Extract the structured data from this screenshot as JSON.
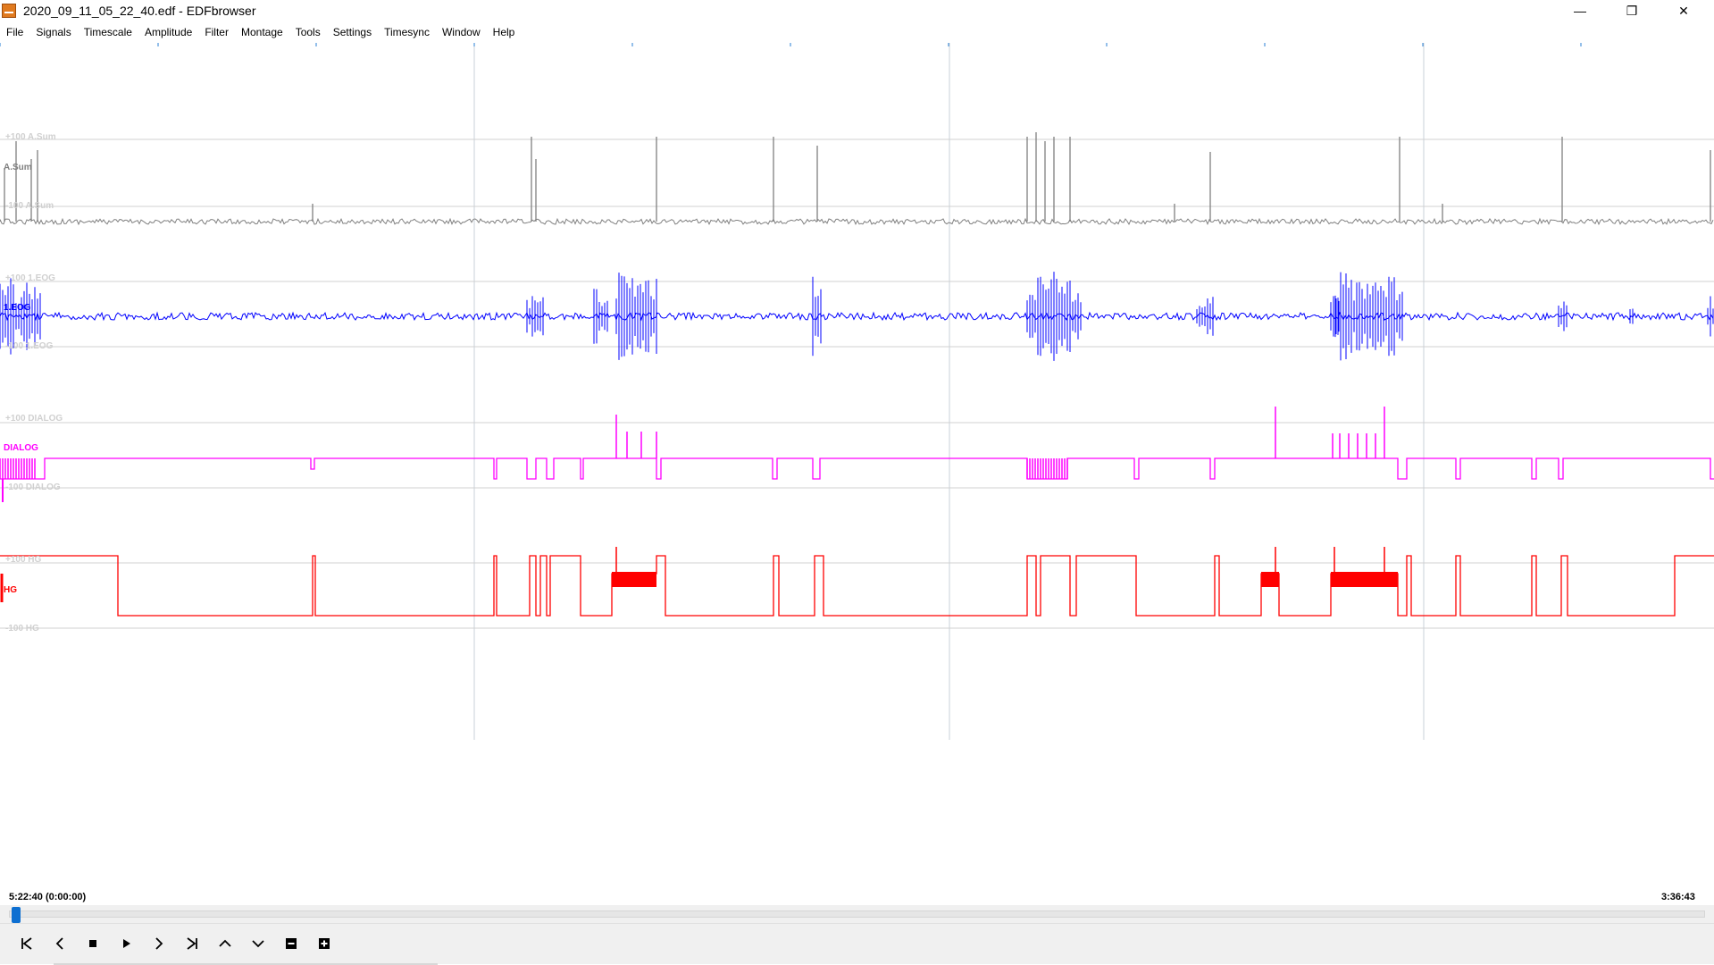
{
  "window": {
    "title": "2020_09_11_05_22_40.edf - EDFbrowser",
    "controls": {
      "minimize": "—",
      "restore": "❐",
      "close": "✕"
    }
  },
  "menu": [
    "File",
    "Signals",
    "Timescale",
    "Amplitude",
    "Filter",
    "Montage",
    "Tools",
    "Settings",
    "Timesync",
    "Window",
    "Help"
  ],
  "signals": [
    {
      "name": "A.Sum",
      "color": "#808080",
      "top_label": "+100 A.Sum",
      "bottom_label": "-100 A.Sum"
    },
    {
      "name": "1.EOG",
      "color": "#0000ff",
      "top_label": "+100 1.EOG",
      "bottom_label": "-100 1.EOG"
    },
    {
      "name": "DIALOG",
      "color": "#ff00ff",
      "top_label": "+100 DIALOG",
      "bottom_label": "-100 DIALOG"
    },
    {
      "name": "HG",
      "color": "#ff0000",
      "top_label": "+100 HG",
      "bottom_label": "-100 HG"
    }
  ],
  "timeline": {
    "start": "5:22:40 (0:00:00)",
    "end": "3:36:43"
  },
  "toolbar": {
    "buttons": [
      {
        "name": "first-page",
        "icon": "skip-back-icon"
      },
      {
        "name": "previous-page",
        "icon": "chevron-left-icon"
      },
      {
        "name": "stop",
        "icon": "stop-icon"
      },
      {
        "name": "play",
        "icon": "play-icon"
      },
      {
        "name": "next-page",
        "icon": "chevron-right-icon"
      },
      {
        "name": "last-page",
        "icon": "skip-forward-icon"
      },
      {
        "name": "scroll-up",
        "icon": "chevron-up-icon"
      },
      {
        "name": "scroll-down",
        "icon": "chevron-down-icon"
      },
      {
        "name": "zoom-out",
        "icon": "minus-box-icon"
      },
      {
        "name": "zoom-in",
        "icon": "plus-box-icon"
      }
    ]
  }
}
